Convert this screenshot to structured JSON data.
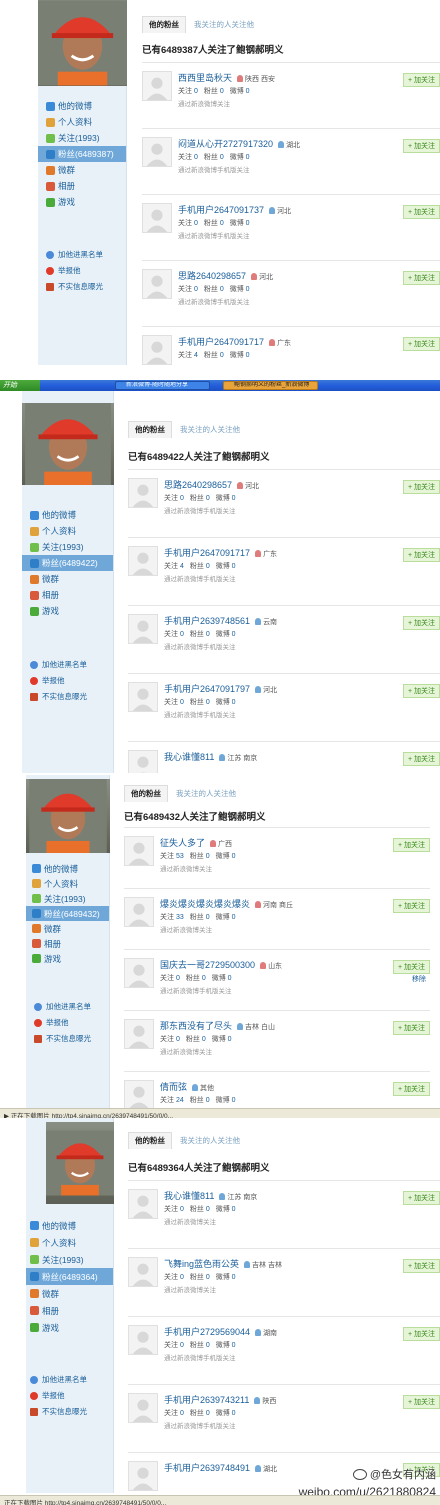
{
  "tabs": {
    "fans": "他的粉丝",
    "following": "我关注的人关注他"
  },
  "nav": {
    "weibo": "他的微博",
    "profile": "个人资料",
    "groups": "微群",
    "album": "相册",
    "games": "游戏"
  },
  "extras": {
    "blacklist": "加他进黑名单",
    "report": "举报他",
    "expose": "不实信息曝光"
  },
  "follow_button": "+ 加关注",
  "remove_fan": "移除",
  "stat_labels": {
    "follow": "关注",
    "fans": "粉丝",
    "weibo": "微博"
  },
  "panels": [
    {
      "following_label": "关注(1993)",
      "fans_label": "粉丝(6489387)",
      "headline": "已有6489387人关注了鲍钢郝明义",
      "fans": [
        {
          "name": "西西里岛秋天",
          "gender": "f",
          "location": "陕西 西安",
          "follow": "0",
          "fans": "0",
          "weibo": "0",
          "via": "通过新浪微博关注"
        },
        {
          "name": "闷道从心开2727917320",
          "gender": "m",
          "location": "湖北",
          "follow": "0",
          "fans": "0",
          "weibo": "0",
          "via": "通过新浪微博手机版关注"
        },
        {
          "name": "手机用户2647091737",
          "gender": "m",
          "location": "河北",
          "follow": "0",
          "fans": "0",
          "weibo": "0",
          "via": "通过新浪微博手机版关注"
        },
        {
          "name": "思路2640298657",
          "gender": "f",
          "location": "河北",
          "follow": "0",
          "fans": "0",
          "weibo": "0",
          "via": "通过新浪微博手机版关注"
        },
        {
          "name": "手机用户2647091717",
          "gender": "f",
          "location": "广东",
          "follow": "4",
          "fans": "0",
          "weibo": "0",
          "via": ""
        }
      ]
    },
    {
      "following_label": "关注(1993)",
      "fans_label": "粉丝(6489422)",
      "headline": "已有6489422人关注了鲍钢郝明义",
      "fans": [
        {
          "name": "思路2640298657",
          "gender": "f",
          "location": "河北",
          "follow": "0",
          "fans": "0",
          "weibo": "0",
          "via": "通过新浪微博手机版关注"
        },
        {
          "name": "手机用户2647091717",
          "gender": "f",
          "location": "广东",
          "follow": "4",
          "fans": "0",
          "weibo": "0",
          "via": "通过新浪微博手机版关注"
        },
        {
          "name": "手机用户2639748561",
          "gender": "m",
          "location": "云南",
          "follow": "0",
          "fans": "0",
          "weibo": "0",
          "via": "通过新浪微博手机版关注"
        },
        {
          "name": "手机用户2647091797",
          "gender": "m",
          "location": "河北",
          "follow": "0",
          "fans": "0",
          "weibo": "0",
          "via": "通过新浪微博手机版关注"
        },
        {
          "name": "我心谁懂811",
          "gender": "m",
          "location": "江苏 南京",
          "follow": "",
          "fans": "",
          "weibo": "",
          "via": ""
        }
      ]
    },
    {
      "following_label": "关注(1993)",
      "fans_label": "粉丝(6489432)",
      "headline": "已有6489432人关注了鲍钢郝明义",
      "fans": [
        {
          "name": "征失人多了",
          "gender": "f",
          "location": "广西",
          "follow": "53",
          "fans": "0",
          "weibo": "0",
          "via": "通过新浪微博关注"
        },
        {
          "name": "爆炎爆炎爆炎爆炎爆炎",
          "gender": "f",
          "location": "河南 商丘",
          "follow": "33",
          "fans": "0",
          "weibo": "0",
          "via": "通过新浪微博关注"
        },
        {
          "name": "国庆去一哥2729500300",
          "gender": "f",
          "location": "山东",
          "follow": "0",
          "fans": "0",
          "weibo": "0",
          "via": "通过新浪微博手机版关注"
        },
        {
          "name": "那东西没有了尽头",
          "gender": "m",
          "location": "吉林 白山",
          "follow": "0",
          "fans": "0",
          "weibo": "0",
          "via": "通过新浪微博关注"
        },
        {
          "name": "倩而弦",
          "gender": "m",
          "location": "其他",
          "follow": "24",
          "fans": "0",
          "weibo": "0",
          "via": ""
        }
      ]
    },
    {
      "following_label": "关注(1993)",
      "fans_label": "粉丝(6489364)",
      "headline": "已有6489364人关注了鲍钢郝明义",
      "fans": [
        {
          "name": "我心谁懂811",
          "gender": "m",
          "location": "江苏 南京",
          "follow": "0",
          "fans": "0",
          "weibo": "0",
          "via": "通过新浪微博关注"
        },
        {
          "name": "飞舞ing蓝色雨公英",
          "gender": "m",
          "location": "吉林 吉林",
          "follow": "0",
          "fans": "0",
          "weibo": "0",
          "via": "通过新浪微博关注"
        },
        {
          "name": "手机用户2729569044",
          "gender": "m",
          "location": "湖南",
          "follow": "0",
          "fans": "0",
          "weibo": "0",
          "via": "通过新浪微博手机版关注"
        },
        {
          "name": "手机用户2639743211",
          "gender": "m",
          "location": "陕西",
          "follow": "0",
          "fans": "0",
          "weibo": "0",
          "via": "通过新浪微博手机版关注"
        },
        {
          "name": "手机用户2639748491",
          "gender": "m",
          "location": "湖北",
          "follow": "",
          "fans": "",
          "weibo": "",
          "via": ""
        }
      ]
    }
  ],
  "taskbar": {
    "start": "开始",
    "buttons": [
      "新浪微博-随时随地分享",
      "鲍钢郝明义的粉丝_新浪微博"
    ]
  },
  "status1": "▶ 正在下载图片 http://tp4.sinaimg.cn/2639748491/50/0/0...",
  "status2": "正在下载图片 http://tp4.sinaimg.cn/2639748491/50/0/0...",
  "watermark": {
    "handle": "@色女有内涵",
    "url": "weibo.com/u/2621880824"
  },
  "colors": {
    "link": "#1a5e9a",
    "sidebar": "#e8f1f7",
    "active_nav": "#6fa8d8",
    "follow_green": "#3a8a1a"
  }
}
